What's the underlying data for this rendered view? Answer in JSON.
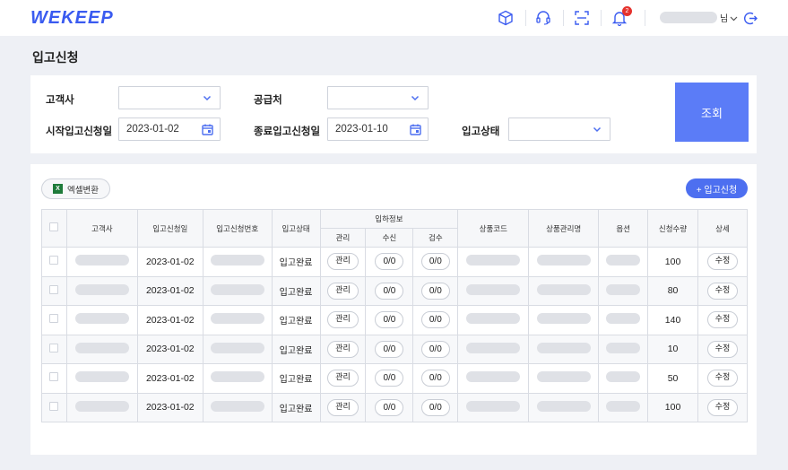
{
  "app": {
    "logo": "WEKEEP",
    "user_suffix": "님"
  },
  "header": {
    "notification_count": "2"
  },
  "page": {
    "title": "입고신청"
  },
  "filters": {
    "customer_label": "고객사",
    "supplier_label": "공급처",
    "start_label": "시작입고신청일",
    "start_value": "2023-01-02",
    "end_label": "종료입고신청일",
    "end_value": "2023-01-10",
    "status_label": "입고상태",
    "search_label": "조회"
  },
  "actions": {
    "excel_label": "엑셀변환",
    "add_label": "+ 입고신청"
  },
  "table": {
    "headers": {
      "customer": "고객사",
      "request_date": "입고신청일",
      "request_no": "입고신청번호",
      "status": "입고상태",
      "arrival_info": "입하정보",
      "manage": "관리",
      "receive": "수신",
      "inspect": "검수",
      "product_code": "상품코드",
      "product_name": "상품관리명",
      "option": "옵션",
      "qty": "신청수량",
      "detail": "상세"
    },
    "rows": [
      {
        "date": "2023-01-02",
        "status": "입고완료",
        "manage": "관리",
        "receive": "0/0",
        "inspect": "0/0",
        "qty": "100",
        "detail": "수정"
      },
      {
        "date": "2023-01-02",
        "status": "입고완료",
        "manage": "관리",
        "receive": "0/0",
        "inspect": "0/0",
        "qty": "80",
        "detail": "수정"
      },
      {
        "date": "2023-01-02",
        "status": "입고완료",
        "manage": "관리",
        "receive": "0/0",
        "inspect": "0/0",
        "qty": "140",
        "detail": "수정"
      },
      {
        "date": "2023-01-02",
        "status": "입고완료",
        "manage": "관리",
        "receive": "0/0",
        "inspect": "0/0",
        "qty": "10",
        "detail": "수정"
      },
      {
        "date": "2023-01-02",
        "status": "입고완료",
        "manage": "관리",
        "receive": "0/0",
        "inspect": "0/0",
        "qty": "50",
        "detail": "수정"
      },
      {
        "date": "2023-01-02",
        "status": "입고완료",
        "manage": "관리",
        "receive": "0/0",
        "inspect": "0/0",
        "qty": "100",
        "detail": "수정"
      }
    ]
  },
  "colors": {
    "brand": "#3a5bf0",
    "primary_button": "#5b7cf7",
    "badge": "#e5322d"
  }
}
